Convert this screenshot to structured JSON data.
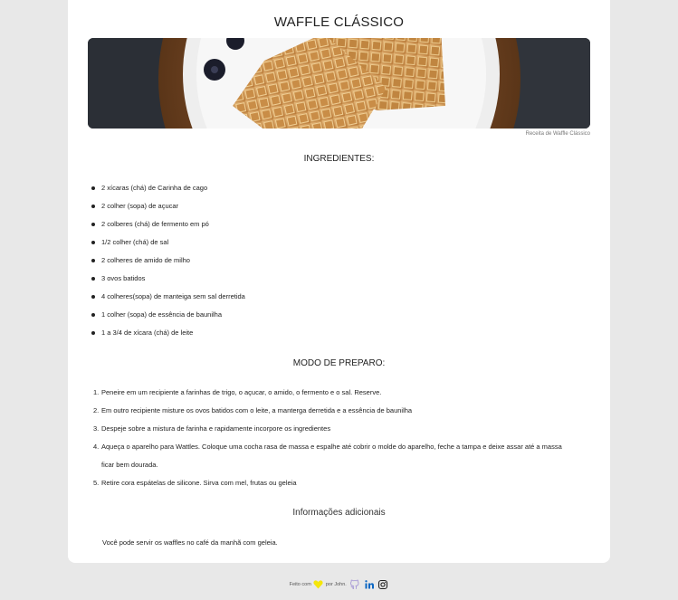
{
  "recipe": {
    "title": "WAFFLE CLÁSSICO",
    "image_caption": "Receita de Waffle Clássico"
  },
  "ingredients": {
    "heading": "INGREDIENTES:",
    "items": [
      "2 xícaras (chá) de Carinha de cago",
      "2 colher (sopa) de açucar",
      "2 colberes (chá) de fermento em pó",
      "1/2 colher (chá) de sal",
      "2 colheres de amido de milho",
      "3 ovos batidos",
      "4 colheres(sopa) de manteiga sem sal derretida",
      "1 colher (sopa) de essência de baunilha",
      "1 a 3/4 de xícara (chá) de leite"
    ]
  },
  "preparation": {
    "heading": "MODO DE PREPARO:",
    "steps": [
      {
        "num": "1.",
        "text": "Peneire em um recipiente a farinhas de trigo, o açucar, o amido, o fermento e o sal. Reserve."
      },
      {
        "num": "2.",
        "text": "Em outro recipiente misture os ovos batidos com o leite, a manterga derretida e a essência de baunilha"
      },
      {
        "num": "3.",
        "text": "Despeje sobre a mistura de farinha e rapidamente incorpore os ingredientes"
      },
      {
        "num": "4.",
        "text": "Aqueça o aparelho para Wattles. Coloque uma cocha rasa de massa e espalhe até cobrir o molde do aparelho, feche a tampa e deixe assar até a massa ficar bem dourada."
      },
      {
        "num": "5.",
        "text": "Retire cora espátelas de silicone. Sirva com mel, frutas ou geleia"
      }
    ]
  },
  "additional": {
    "heading": "Informações adicionais",
    "text": "Você pode servir os waffles no café da manhã com geleia."
  },
  "footer": {
    "made_with": "Feito com",
    "by": "por John.",
    "heart_icon": "heart-icon",
    "heart_color": "#f5e60a",
    "links": [
      {
        "icon": "github-icon",
        "color": "#a89ad6"
      },
      {
        "icon": "linkedin-icon",
        "color": "#0a66c2"
      },
      {
        "icon": "instagram-icon",
        "color": "#222222"
      }
    ]
  }
}
